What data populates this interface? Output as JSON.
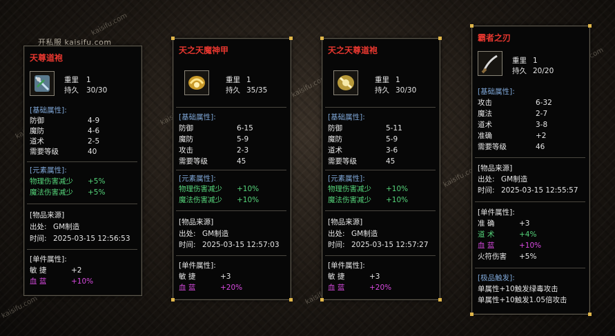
{
  "watermark": "开私服 kaisifu.com",
  "watermark_diag": "kaisifu.com",
  "colors": {
    "title_red": "#e8372f",
    "section_blue": "#7ea6d6",
    "green": "#55d47a",
    "magenta": "#d84ae0",
    "gold_corner": "#e0b64a"
  },
  "cards": [
    {
      "title": "天尊道袍",
      "icon": "robe-icon",
      "weight_label": "重里",
      "weight": "1",
      "durability_label": "持久",
      "durability": "30/30",
      "base_header": "[基础属性]:",
      "base_stats": [
        {
          "label": "防御",
          "value": "4-9"
        },
        {
          "label": "魔防",
          "value": "4-6"
        },
        {
          "label": "道术",
          "value": "2-5"
        },
        {
          "label": "需要等级",
          "value": "40"
        }
      ],
      "element_header": "[元素属性]:",
      "element_stats": [
        {
          "label": "物理伤害减少",
          "value": "+5%"
        },
        {
          "label": "魔法伤害减少",
          "value": "+5%"
        }
      ],
      "source_header": "[物品来源]",
      "source_origin_label": "出处:",
      "source_origin": "GM制造",
      "source_time_label": "时间:",
      "source_time": "2025-03-15 12:56:53",
      "single_header": "[单件属性]:",
      "single_stats": [
        {
          "label": "敏 捷",
          "value": "+2"
        },
        {
          "label": "血 蓝",
          "value": "+10%"
        }
      ]
    },
    {
      "title": "天之天魔神甲",
      "icon": "armor-icon",
      "weight_label": "重里",
      "weight": "1",
      "durability_label": "持久",
      "durability": "35/35",
      "base_header": "[基础属性]:",
      "base_stats": [
        {
          "label": "防御",
          "value": "6-15"
        },
        {
          "label": "魔防",
          "value": "5-9"
        },
        {
          "label": "攻击",
          "value": "2-3"
        },
        {
          "label": "需要等级",
          "value": "45"
        }
      ],
      "element_header": "[元素属性]:",
      "element_stats": [
        {
          "label": "物理伤害减少",
          "value": "+10%"
        },
        {
          "label": "魔法伤害减少",
          "value": "+10%"
        }
      ],
      "source_header": "[物品来源]",
      "source_origin_label": "出处:",
      "source_origin": "GM制造",
      "source_time_label": "时间:",
      "source_time": "2025-03-15 12:57:03",
      "single_header": "[单件属性]:",
      "single_stats": [
        {
          "label": "敏 捷",
          "value": "+3"
        },
        {
          "label": "血 蓝",
          "value": "+20%"
        }
      ]
    },
    {
      "title": "天之天尊道袍",
      "icon": "robe-icon",
      "weight_label": "重里",
      "weight": "1",
      "durability_label": "持久",
      "durability": "30/30",
      "base_header": "[基础属性]:",
      "base_stats": [
        {
          "label": "防御",
          "value": "5-11"
        },
        {
          "label": "魔防",
          "value": "5-9"
        },
        {
          "label": "道术",
          "value": "3-6"
        },
        {
          "label": "需要等级",
          "value": "45"
        }
      ],
      "element_header": "[元素属性]:",
      "element_stats": [
        {
          "label": "物理伤害减少",
          "value": "+10%"
        },
        {
          "label": "魔法伤害减少",
          "value": "+10%"
        }
      ],
      "source_header": "[物品来源]",
      "source_origin_label": "出处:",
      "source_origin": "GM制造",
      "source_time_label": "时间:",
      "source_time": "2025-03-15 12:57:27",
      "single_header": "[单件属性]:",
      "single_stats": [
        {
          "label": "敏 捷",
          "value": "+3"
        },
        {
          "label": "血 蓝",
          "value": "+20%"
        }
      ]
    },
    {
      "title": "霸者之刃",
      "icon": "blade-icon",
      "weight_label": "重里",
      "weight": "1",
      "durability_label": "持久",
      "durability": "20/20",
      "base_header": "[基础属性]:",
      "base_stats": [
        {
          "label": "攻击",
          "value": "6-32"
        },
        {
          "label": "魔法",
          "value": "2-7"
        },
        {
          "label": "道术",
          "value": "3-8"
        },
        {
          "label": "准确",
          "value": "+2"
        },
        {
          "label": "需要等级",
          "value": "46"
        }
      ],
      "source_header": "[物品来源]",
      "source_origin_label": "出处:",
      "source_origin": "GM制造",
      "source_time_label": "时间:",
      "source_time": "2025-03-15 12:55:57",
      "single_header": "[单件属性]:",
      "single_stats": [
        {
          "label": "准 确",
          "value": "+3"
        },
        {
          "label": "道 术",
          "value": "+4%"
        },
        {
          "label": "血 蓝",
          "value": "+10%"
        },
        {
          "label": "火符伤害",
          "value": "+5%"
        }
      ],
      "extreme_header": "[极品触发]:",
      "extreme_lines": [
        "单属性+10触发绿毒攻击",
        "单属性+10触发1.05倍攻击"
      ]
    }
  ]
}
